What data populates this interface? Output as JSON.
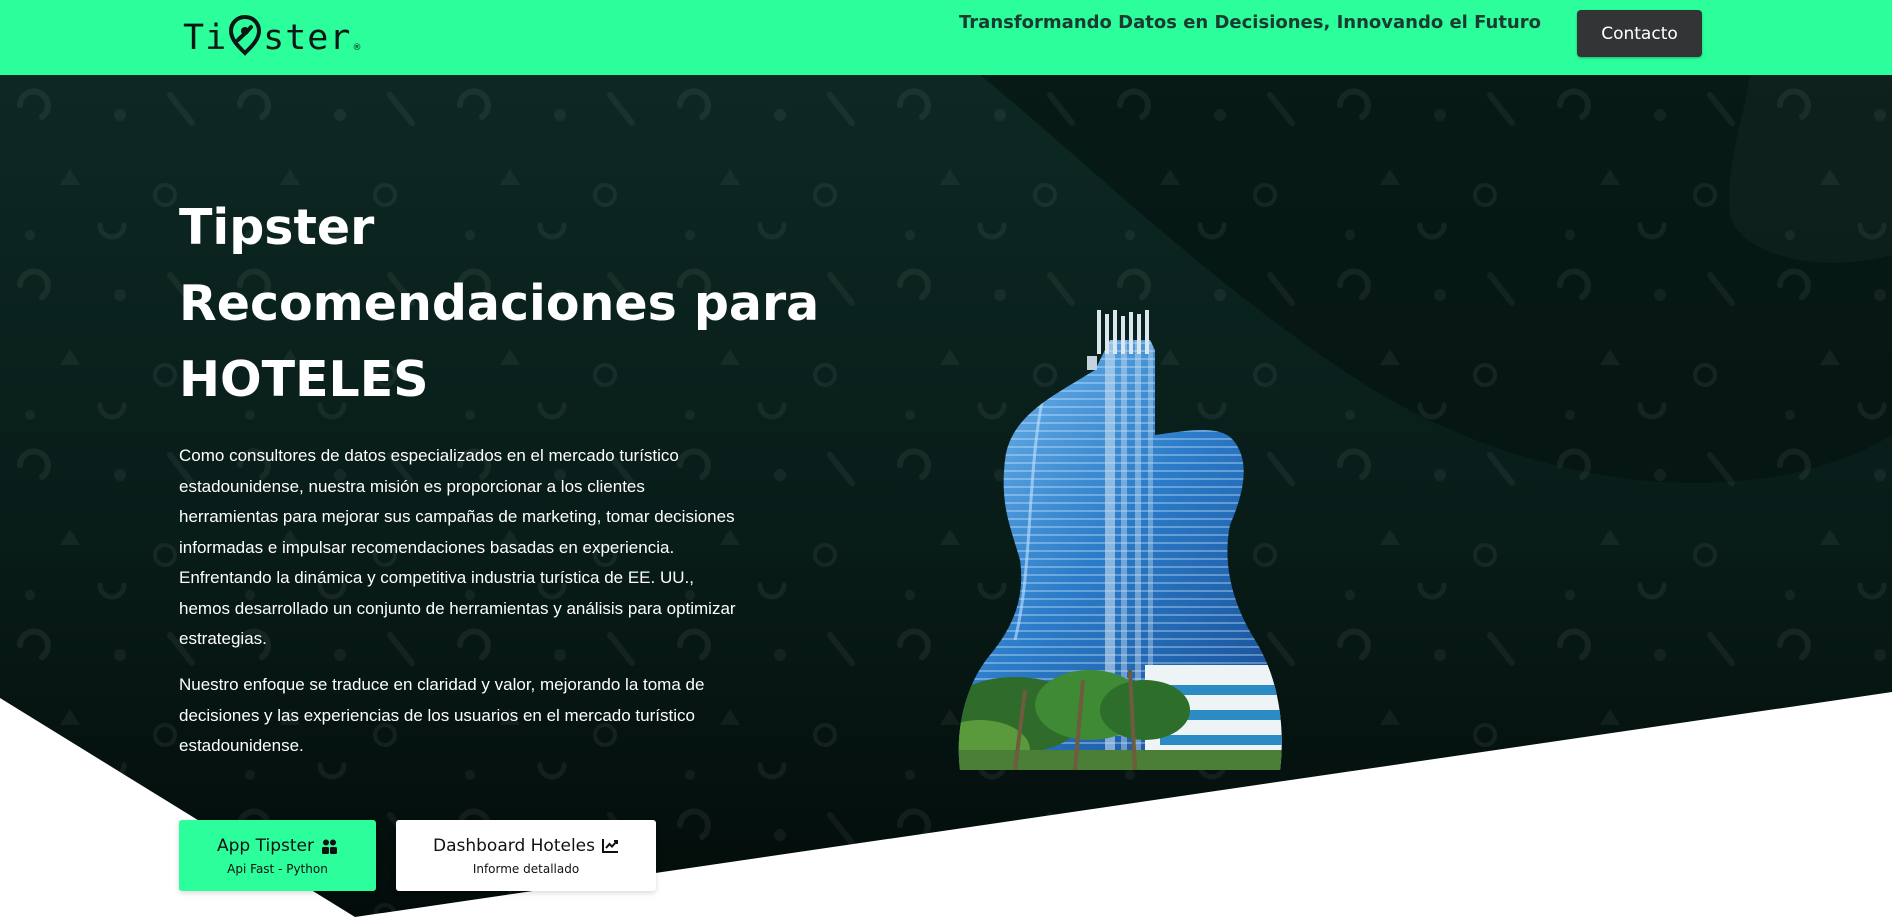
{
  "header": {
    "logo": {
      "before": "Ti",
      "after": "ster",
      "mark": "®"
    },
    "tagline": "Transformando Datos en Decisiones, Innovando el Futuro",
    "contact_label": "Contacto"
  },
  "hero": {
    "title_lines": [
      "Tipster",
      "Recomendaciones para",
      "HOTELES"
    ],
    "paragraph_1": "Como consultores de datos especializados en el mercado turístico estadounidense, nuestra misión es proporcionar a los clientes herramientas para mejorar sus campañas de marketing, tomar decisiones informadas e impulsar recomendaciones basadas en experiencia. Enfrentando la dinámica y competitiva industria turística de EE. UU., hemos desarrollado un conjunto de herramientas y análisis para optimizar estrategias.",
    "paragraph_2": "Nuestro enfoque se traduce en claridad y valor, mejorando la toma de decisiones y las experiencias de los usuarios en el mercado turístico estadounidense."
  },
  "buttons": {
    "app": {
      "label": "App Tipster",
      "sublabel": "Api Fast - Python",
      "icon": "users-icon"
    },
    "dashboard": {
      "label": "Dashboard Hoteles",
      "sublabel": "Informe detallado",
      "icon": "chart-line-icon"
    }
  },
  "colors": {
    "accent": "#2cfe9c",
    "hero_dark": "#071815",
    "button_dark": "#333436"
  }
}
